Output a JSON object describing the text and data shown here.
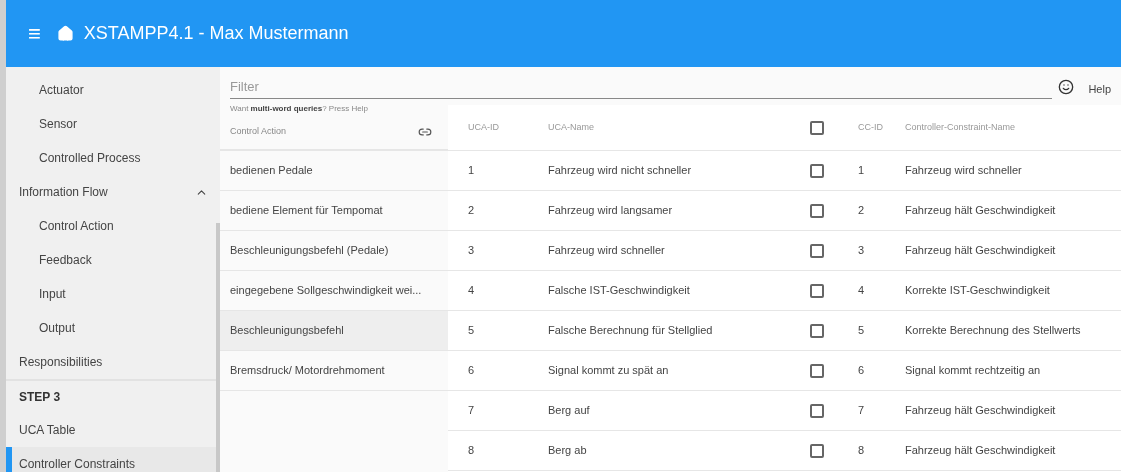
{
  "header": {
    "menu_icon": "≡",
    "title": "XSTAMPP4.1 - Max Mustermann"
  },
  "sidebar": {
    "items": [
      {
        "kind": "sub",
        "label": "Actuator",
        "selected": false
      },
      {
        "kind": "sub",
        "label": "Sensor",
        "selected": false
      },
      {
        "kind": "sub",
        "label": "Controlled Process",
        "selected": false
      },
      {
        "kind": "group",
        "label": "Information Flow",
        "expanded": true,
        "selected": false
      },
      {
        "kind": "sub",
        "label": "Control Action",
        "selected": false
      },
      {
        "kind": "sub",
        "label": "Feedback",
        "selected": false
      },
      {
        "kind": "sub",
        "label": "Input",
        "selected": false
      },
      {
        "kind": "sub",
        "label": "Output",
        "selected": false
      },
      {
        "kind": "item",
        "label": "Responsibilities",
        "selected": false
      },
      {
        "kind": "section",
        "label": "STEP 3"
      },
      {
        "kind": "item",
        "label": "UCA Table",
        "selected": false
      },
      {
        "kind": "item",
        "label": "Controller Constraints",
        "selected": true
      }
    ]
  },
  "filter": {
    "placeholder": "Filter",
    "hint": "Want **multi-word queries**? Press Help",
    "help": "Help"
  },
  "control_actions": {
    "heading": "Control Action",
    "items": [
      {
        "label": "bedienen Pedale",
        "selected": false
      },
      {
        "label": "bediene Element für Tempomat",
        "selected": false
      },
      {
        "label": "Beschleunigungsbefehl (Pedale)",
        "selected": false
      },
      {
        "label": "eingegebene Sollgeschwindigkeit wei...",
        "selected": false
      },
      {
        "label": "Beschleunigungsbefehl",
        "selected": true
      },
      {
        "label": "Bremsdruck/ Motordrehmoment",
        "selected": false
      }
    ]
  },
  "table": {
    "columns": [
      "UCA-ID",
      "UCA-Name",
      "CC-ID",
      "Controller-Constraint-Name"
    ],
    "header_checked": false,
    "rows": [
      {
        "uca_id": "1",
        "uca_name": "Fahrzeug wird nicht schneller",
        "checked": false,
        "cc_id": "1",
        "cc_name": "Fahrzeug wird schneller"
      },
      {
        "uca_id": "2",
        "uca_name": "Fahrzeug wird langsamer",
        "checked": false,
        "cc_id": "2",
        "cc_name": "Fahrzeug hält Geschwindigkeit"
      },
      {
        "uca_id": "3",
        "uca_name": "Fahrzeug wird schneller",
        "checked": false,
        "cc_id": "3",
        "cc_name": "Fahrzeug hält Geschwindigkeit"
      },
      {
        "uca_id": "4",
        "uca_name": "Falsche IST-Geschwindigkeit",
        "checked": false,
        "cc_id": "4",
        "cc_name": "Korrekte IST-Geschwindigkeit"
      },
      {
        "uca_id": "5",
        "uca_name": "Falsche Berechnung für Stellglied",
        "checked": false,
        "cc_id": "5",
        "cc_name": "Korrekte Berechnung des Stellwerts"
      },
      {
        "uca_id": "6",
        "uca_name": "Signal kommt zu spät an",
        "checked": false,
        "cc_id": "6",
        "cc_name": "Signal kommt rechtzeitig an"
      },
      {
        "uca_id": "7",
        "uca_name": "Berg auf",
        "checked": false,
        "cc_id": "7",
        "cc_name": "Fahrzeug hält Geschwindigkeit"
      },
      {
        "uca_id": "8",
        "uca_name": "Berg ab",
        "checked": false,
        "cc_id": "8",
        "cc_name": "Fahrzeug hält Geschwindigkeit"
      }
    ]
  }
}
